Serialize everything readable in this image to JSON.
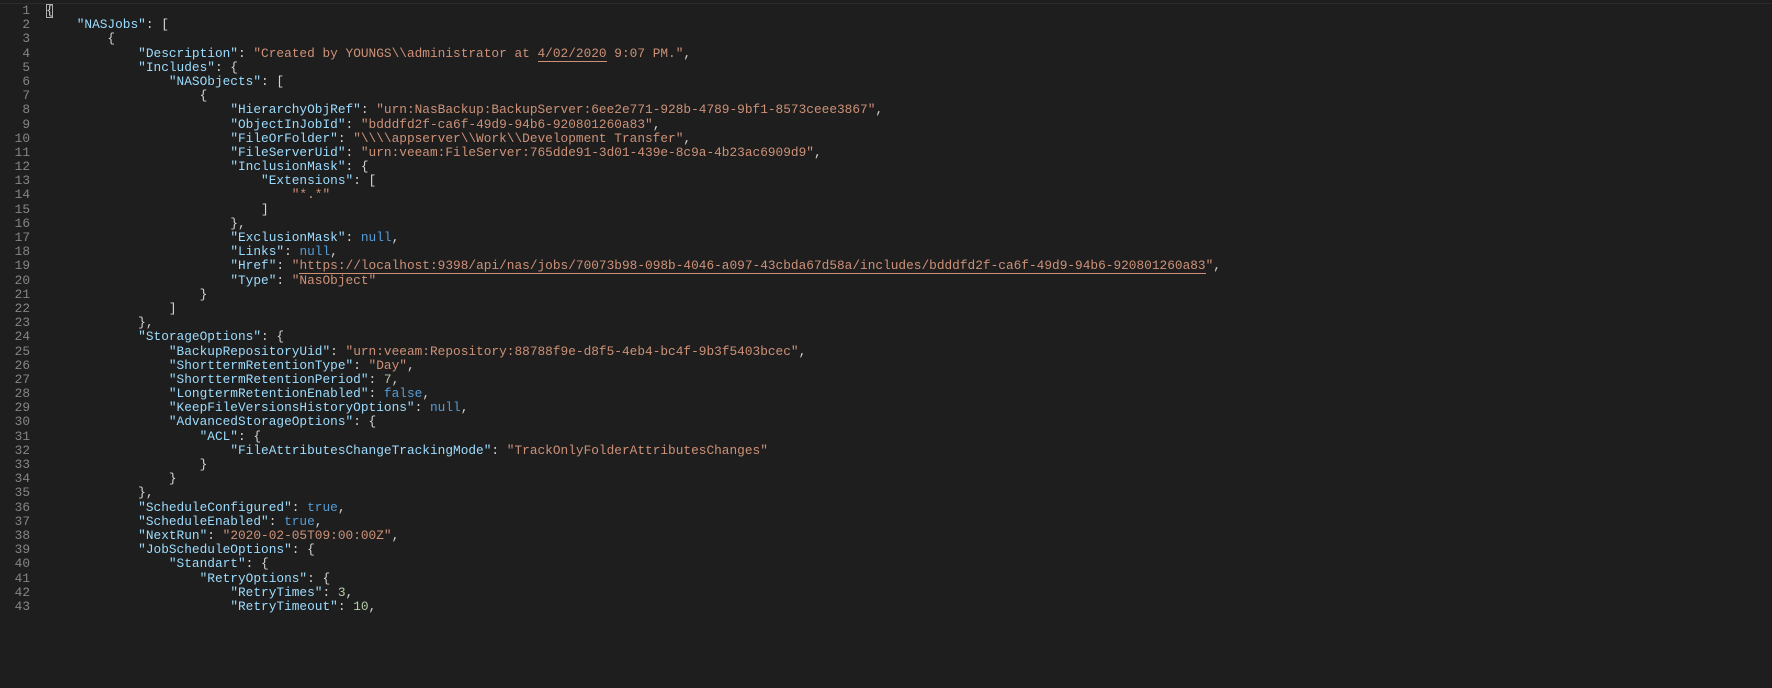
{
  "lines": [
    {
      "n": 1,
      "segs": [
        {
          "t": "{",
          "c": "punct",
          "cursor": true
        }
      ]
    },
    {
      "n": 2,
      "segs": [
        {
          "t": "    ",
          "c": "punct"
        },
        {
          "t": "\"NASJobs\"",
          "c": "key"
        },
        {
          "t": ": [",
          "c": "punct"
        }
      ]
    },
    {
      "n": 3,
      "segs": [
        {
          "t": "        {",
          "c": "punct"
        }
      ]
    },
    {
      "n": 4,
      "segs": [
        {
          "t": "            ",
          "c": "punct"
        },
        {
          "t": "\"Description\"",
          "c": "key"
        },
        {
          "t": ": ",
          "c": "punct"
        },
        {
          "t": "\"Created by YOUNGS\\\\administrator at ",
          "c": "string"
        },
        {
          "t": "4/02/2020",
          "c": "string underline2"
        },
        {
          "t": " 9:07 PM.\"",
          "c": "string"
        },
        {
          "t": ",",
          "c": "punct"
        }
      ]
    },
    {
      "n": 5,
      "segs": [
        {
          "t": "            ",
          "c": "punct"
        },
        {
          "t": "\"Includes\"",
          "c": "key"
        },
        {
          "t": ": {",
          "c": "punct"
        }
      ]
    },
    {
      "n": 6,
      "segs": [
        {
          "t": "                ",
          "c": "punct"
        },
        {
          "t": "\"NASObjects\"",
          "c": "key"
        },
        {
          "t": ": [",
          "c": "punct"
        }
      ]
    },
    {
      "n": 7,
      "segs": [
        {
          "t": "                    {",
          "c": "punct"
        }
      ]
    },
    {
      "n": 8,
      "segs": [
        {
          "t": "                        ",
          "c": "punct"
        },
        {
          "t": "\"HierarchyObjRef\"",
          "c": "key"
        },
        {
          "t": ": ",
          "c": "punct"
        },
        {
          "t": "\"urn:NasBackup:BackupServer:6ee2e771-928b-4789-9bf1-8573ceee3867\"",
          "c": "string"
        },
        {
          "t": ",",
          "c": "punct"
        }
      ]
    },
    {
      "n": 9,
      "segs": [
        {
          "t": "                        ",
          "c": "punct"
        },
        {
          "t": "\"ObjectInJobId\"",
          "c": "key"
        },
        {
          "t": ": ",
          "c": "punct"
        },
        {
          "t": "\"bdddfd2f-ca6f-49d9-94b6-920801260a83\"",
          "c": "string"
        },
        {
          "t": ",",
          "c": "punct"
        }
      ]
    },
    {
      "n": 10,
      "segs": [
        {
          "t": "                        ",
          "c": "punct"
        },
        {
          "t": "\"FileOrFolder\"",
          "c": "key"
        },
        {
          "t": ": ",
          "c": "punct"
        },
        {
          "t": "\"\\\\\\\\appserver\\\\Work\\\\Development Transfer\"",
          "c": "string"
        },
        {
          "t": ",",
          "c": "punct"
        }
      ]
    },
    {
      "n": 11,
      "segs": [
        {
          "t": "                        ",
          "c": "punct"
        },
        {
          "t": "\"FileServerUid\"",
          "c": "key"
        },
        {
          "t": ": ",
          "c": "punct"
        },
        {
          "t": "\"urn:veeam:FileServer:765dde91-3d01-439e-8c9a-4b23ac6909d9\"",
          "c": "string"
        },
        {
          "t": ",",
          "c": "punct"
        }
      ]
    },
    {
      "n": 12,
      "segs": [
        {
          "t": "                        ",
          "c": "punct"
        },
        {
          "t": "\"InclusionMask\"",
          "c": "key"
        },
        {
          "t": ": {",
          "c": "punct"
        }
      ]
    },
    {
      "n": 13,
      "segs": [
        {
          "t": "                            ",
          "c": "punct"
        },
        {
          "t": "\"Extensions\"",
          "c": "key"
        },
        {
          "t": ": [",
          "c": "punct"
        }
      ]
    },
    {
      "n": 14,
      "segs": [
        {
          "t": "                                ",
          "c": "punct"
        },
        {
          "t": "\"*.*\"",
          "c": "string"
        }
      ]
    },
    {
      "n": 15,
      "segs": [
        {
          "t": "                            ]",
          "c": "punct"
        }
      ]
    },
    {
      "n": 16,
      "segs": [
        {
          "t": "                        },",
          "c": "punct"
        }
      ]
    },
    {
      "n": 17,
      "segs": [
        {
          "t": "                        ",
          "c": "punct"
        },
        {
          "t": "\"ExclusionMask\"",
          "c": "key"
        },
        {
          "t": ": ",
          "c": "punct"
        },
        {
          "t": "null",
          "c": "keyword"
        },
        {
          "t": ",",
          "c": "punct"
        }
      ]
    },
    {
      "n": 18,
      "segs": [
        {
          "t": "                        ",
          "c": "punct"
        },
        {
          "t": "\"Links\"",
          "c": "key"
        },
        {
          "t": ": ",
          "c": "punct"
        },
        {
          "t": "null",
          "c": "keyword"
        },
        {
          "t": ",",
          "c": "punct"
        }
      ]
    },
    {
      "n": 19,
      "segs": [
        {
          "t": "                        ",
          "c": "punct"
        },
        {
          "t": "\"Href\"",
          "c": "key"
        },
        {
          "t": ": ",
          "c": "punct"
        },
        {
          "t": "\"",
          "c": "string"
        },
        {
          "t": "https://localhost:9398/api/nas/jobs/70073b98-098b-4046-a097-43cbda67d58a/includes/bdddfd2f-ca6f-49d9-94b6-920801260a83",
          "c": "string underline"
        },
        {
          "t": "\"",
          "c": "string"
        },
        {
          "t": ",",
          "c": "punct"
        }
      ]
    },
    {
      "n": 20,
      "segs": [
        {
          "t": "                        ",
          "c": "punct"
        },
        {
          "t": "\"Type\"",
          "c": "key"
        },
        {
          "t": ": ",
          "c": "punct"
        },
        {
          "t": "\"NasObject\"",
          "c": "string"
        }
      ]
    },
    {
      "n": 21,
      "segs": [
        {
          "t": "                    }",
          "c": "punct"
        }
      ]
    },
    {
      "n": 22,
      "segs": [
        {
          "t": "                ]",
          "c": "punct"
        }
      ]
    },
    {
      "n": 23,
      "segs": [
        {
          "t": "            },",
          "c": "punct"
        }
      ]
    },
    {
      "n": 24,
      "segs": [
        {
          "t": "            ",
          "c": "punct"
        },
        {
          "t": "\"StorageOptions\"",
          "c": "key"
        },
        {
          "t": ": {",
          "c": "punct"
        }
      ]
    },
    {
      "n": 25,
      "segs": [
        {
          "t": "                ",
          "c": "punct"
        },
        {
          "t": "\"BackupRepositoryUid\"",
          "c": "key"
        },
        {
          "t": ": ",
          "c": "punct"
        },
        {
          "t": "\"urn:veeam:Repository:88788f9e-d8f5-4eb4-bc4f-9b3f5403bcec\"",
          "c": "string"
        },
        {
          "t": ",",
          "c": "punct"
        }
      ]
    },
    {
      "n": 26,
      "segs": [
        {
          "t": "                ",
          "c": "punct"
        },
        {
          "t": "\"ShorttermRetentionType\"",
          "c": "key"
        },
        {
          "t": ": ",
          "c": "punct"
        },
        {
          "t": "\"Day\"",
          "c": "string"
        },
        {
          "t": ",",
          "c": "punct"
        }
      ]
    },
    {
      "n": 27,
      "segs": [
        {
          "t": "                ",
          "c": "punct"
        },
        {
          "t": "\"ShorttermRetentionPeriod\"",
          "c": "key"
        },
        {
          "t": ": ",
          "c": "punct"
        },
        {
          "t": "7",
          "c": "number"
        },
        {
          "t": ",",
          "c": "punct"
        }
      ]
    },
    {
      "n": 28,
      "segs": [
        {
          "t": "                ",
          "c": "punct"
        },
        {
          "t": "\"LongtermRetentionEnabled\"",
          "c": "key"
        },
        {
          "t": ": ",
          "c": "punct"
        },
        {
          "t": "false",
          "c": "keyword"
        },
        {
          "t": ",",
          "c": "punct"
        }
      ]
    },
    {
      "n": 29,
      "segs": [
        {
          "t": "                ",
          "c": "punct"
        },
        {
          "t": "\"KeepFileVersionsHistoryOptions\"",
          "c": "key"
        },
        {
          "t": ": ",
          "c": "punct"
        },
        {
          "t": "null",
          "c": "keyword"
        },
        {
          "t": ",",
          "c": "punct"
        }
      ]
    },
    {
      "n": 30,
      "segs": [
        {
          "t": "                ",
          "c": "punct"
        },
        {
          "t": "\"AdvancedStorageOptions\"",
          "c": "key"
        },
        {
          "t": ": {",
          "c": "punct"
        }
      ]
    },
    {
      "n": 31,
      "segs": [
        {
          "t": "                    ",
          "c": "punct"
        },
        {
          "t": "\"ACL\"",
          "c": "key"
        },
        {
          "t": ": {",
          "c": "punct"
        }
      ]
    },
    {
      "n": 32,
      "segs": [
        {
          "t": "                        ",
          "c": "punct"
        },
        {
          "t": "\"FileAttributesChangeTrackingMode\"",
          "c": "key"
        },
        {
          "t": ": ",
          "c": "punct"
        },
        {
          "t": "\"TrackOnlyFolderAttributesChanges\"",
          "c": "string"
        }
      ]
    },
    {
      "n": 33,
      "segs": [
        {
          "t": "                    }",
          "c": "punct"
        }
      ]
    },
    {
      "n": 34,
      "segs": [
        {
          "t": "                }",
          "c": "punct"
        }
      ]
    },
    {
      "n": 35,
      "segs": [
        {
          "t": "            },",
          "c": "punct"
        }
      ]
    },
    {
      "n": 36,
      "segs": [
        {
          "t": "            ",
          "c": "punct"
        },
        {
          "t": "\"ScheduleConfigured\"",
          "c": "key"
        },
        {
          "t": ": ",
          "c": "punct"
        },
        {
          "t": "true",
          "c": "keyword"
        },
        {
          "t": ",",
          "c": "punct"
        }
      ]
    },
    {
      "n": 37,
      "segs": [
        {
          "t": "            ",
          "c": "punct"
        },
        {
          "t": "\"ScheduleEnabled\"",
          "c": "key"
        },
        {
          "t": ": ",
          "c": "punct"
        },
        {
          "t": "true",
          "c": "keyword"
        },
        {
          "t": ",",
          "c": "punct"
        }
      ]
    },
    {
      "n": 38,
      "segs": [
        {
          "t": "            ",
          "c": "punct"
        },
        {
          "t": "\"NextRun\"",
          "c": "key"
        },
        {
          "t": ": ",
          "c": "punct"
        },
        {
          "t": "\"2020-02-05T09:00:00Z\"",
          "c": "string"
        },
        {
          "t": ",",
          "c": "punct"
        }
      ]
    },
    {
      "n": 39,
      "segs": [
        {
          "t": "            ",
          "c": "punct"
        },
        {
          "t": "\"JobScheduleOptions\"",
          "c": "key"
        },
        {
          "t": ": {",
          "c": "punct"
        }
      ]
    },
    {
      "n": 40,
      "segs": [
        {
          "t": "                ",
          "c": "punct"
        },
        {
          "t": "\"Standart\"",
          "c": "key"
        },
        {
          "t": ": {",
          "c": "punct"
        }
      ]
    },
    {
      "n": 41,
      "segs": [
        {
          "t": "                    ",
          "c": "punct"
        },
        {
          "t": "\"RetryOptions\"",
          "c": "key"
        },
        {
          "t": ": {",
          "c": "punct"
        }
      ]
    },
    {
      "n": 42,
      "segs": [
        {
          "t": "                        ",
          "c": "punct"
        },
        {
          "t": "\"RetryTimes\"",
          "c": "key"
        },
        {
          "t": ": ",
          "c": "punct"
        },
        {
          "t": "3",
          "c": "number"
        },
        {
          "t": ",",
          "c": "punct"
        }
      ]
    },
    {
      "n": 43,
      "segs": [
        {
          "t": "                        ",
          "c": "punct"
        },
        {
          "t": "\"RetryTimeout\"",
          "c": "key"
        },
        {
          "t": ": ",
          "c": "punct"
        },
        {
          "t": "10",
          "c": "number"
        },
        {
          "t": ",",
          "c": "punct"
        }
      ]
    }
  ]
}
